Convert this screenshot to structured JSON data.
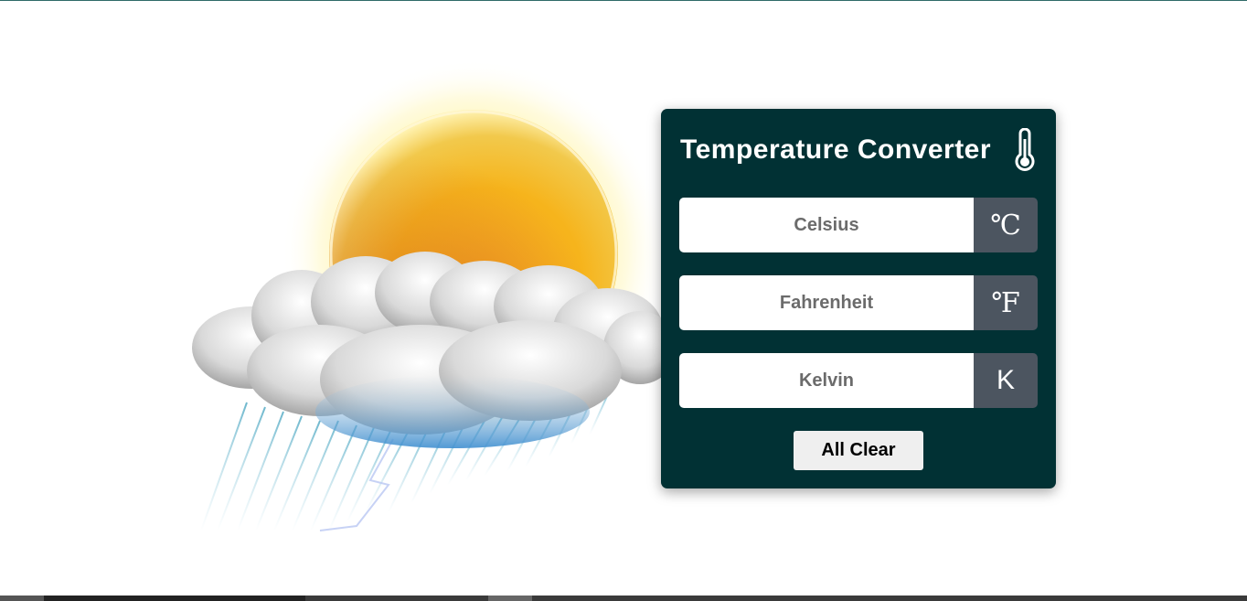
{
  "converter": {
    "title": "Temperature Converter",
    "title_icon": "thermometer-icon",
    "fields": [
      {
        "placeholder": "Celsius",
        "value": "",
        "unit": "℃"
      },
      {
        "placeholder": "Fahrenheit",
        "value": "",
        "unit": "℉"
      },
      {
        "placeholder": "Kelvin",
        "value": "",
        "unit": "K"
      }
    ],
    "clear_label": "All Clear"
  },
  "illustration": {
    "icon": "sun-cloud-rain-icon"
  },
  "colors": {
    "card_bg": "#013134",
    "unit_bg": "#4c5560",
    "button_bg": "#efefef"
  }
}
